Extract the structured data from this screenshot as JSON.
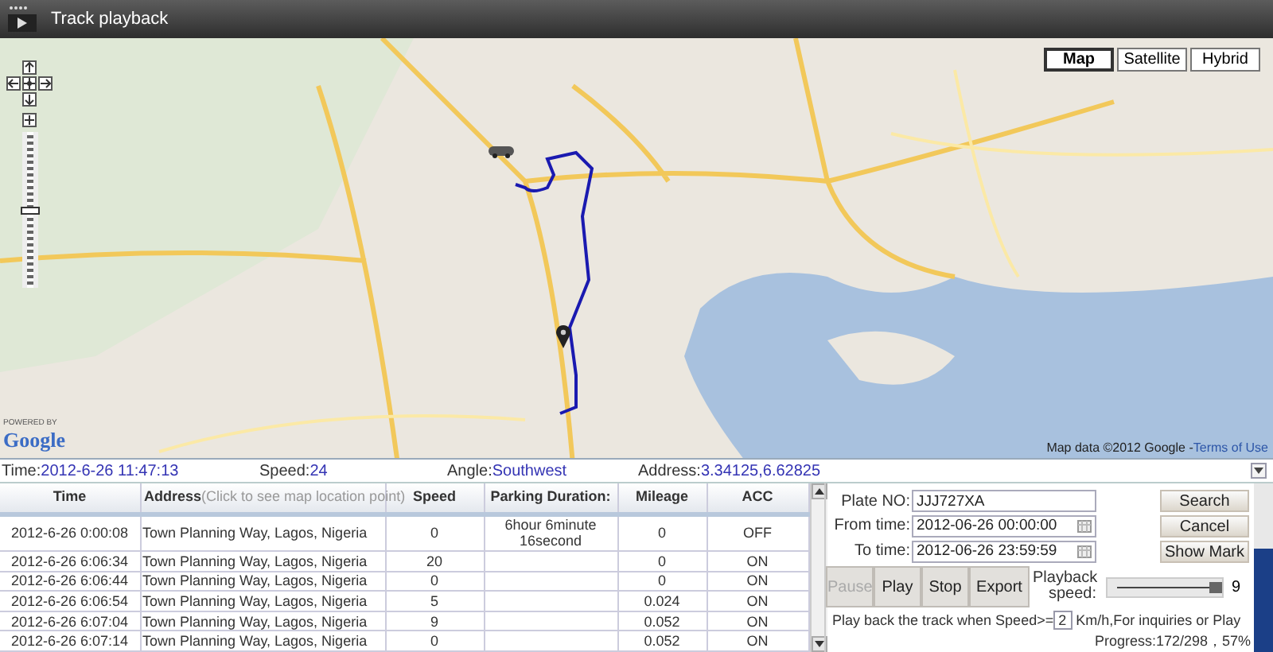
{
  "window": {
    "title": "Track playback"
  },
  "map": {
    "map_types": [
      {
        "label": "Map",
        "selected": true
      },
      {
        "label": "Satellite",
        "selected": false
      },
      {
        "label": "Hybrid",
        "selected": false
      }
    ],
    "zoom": {
      "level": 0.5
    },
    "logo_caption": "POWERED BY",
    "logo": "Google",
    "attribution": "Map data ©2012 Google - ",
    "terms_link": "Terms of Use"
  },
  "info": [
    {
      "label": "Time:",
      "value": "2012-6-26 11:47:13"
    },
    {
      "label": "Speed:",
      "value": "24"
    },
    {
      "label": "Angle:",
      "value": "Southwest"
    },
    {
      "label": "Address:",
      "value": "3.34125,6.62825"
    }
  ],
  "table": {
    "columns": [
      {
        "label": "Time"
      },
      {
        "label": "Address",
        "hint": "(Click to see map location point)"
      },
      {
        "label": "Speed"
      },
      {
        "label": "Parking Duration:"
      },
      {
        "label": "Mileage"
      },
      {
        "label": "ACC"
      }
    ],
    "rows": [
      [
        "2012-6-26 0:00:08",
        "Town Planning Way, Lagos, Nigeria",
        "0",
        "6hour 6minute 16second",
        "0",
        "OFF"
      ],
      [
        "2012-6-26 6:06:34",
        "Town Planning Way, Lagos, Nigeria",
        "20",
        "",
        "0",
        "ON"
      ],
      [
        "2012-6-26 6:06:44",
        "Town Planning Way, Lagos, Nigeria",
        "0",
        "",
        "0",
        "ON"
      ],
      [
        "2012-6-26 6:06:54",
        "Town Planning Way, Lagos, Nigeria",
        "5",
        "",
        "0.024",
        "ON"
      ],
      [
        "2012-6-26 6:07:04",
        "Town Planning Way, Lagos, Nigeria",
        "9",
        "",
        "0.052",
        "ON"
      ],
      [
        "2012-6-26 6:07:14",
        "Town Planning Way, Lagos, Nigeria",
        "0",
        "",
        "0.052",
        "ON"
      ]
    ]
  },
  "controls": {
    "fields": [
      {
        "label": "Plate NO:",
        "value": "JJJ727XA",
        "kind": "text"
      },
      {
        "label": "From time:",
        "value": "2012-06-26 00:00:00",
        "kind": "date"
      },
      {
        "label": "To time:",
        "value": "2012-06-26 23:59:59",
        "kind": "date"
      }
    ],
    "side_buttons": [
      "Search",
      "Cancel",
      "Show Mark"
    ],
    "playback_buttons": [
      {
        "label": "Pause",
        "disabled": true
      },
      {
        "label": "Play",
        "disabled": false
      },
      {
        "label": "Stop",
        "disabled": false
      },
      {
        "label": "Export",
        "disabled": false
      }
    ],
    "speed": {
      "label": "Playback speed:",
      "level": 0.95,
      "reading": "9"
    },
    "threshold": {
      "prefix": "Play back the track when Speed>=",
      "value": "2",
      "suffix": "Km/h,For inquiries or Play"
    },
    "progress": "Progress:172/298，57%"
  }
}
